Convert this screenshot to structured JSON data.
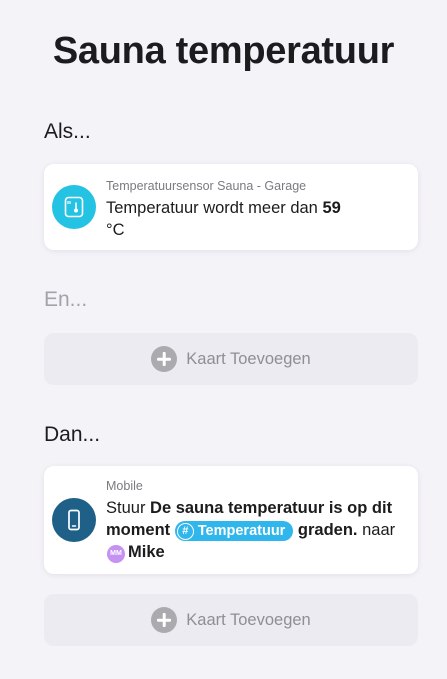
{
  "title": "Sauna temperatuur",
  "sections": {
    "if": {
      "heading": "Als...",
      "card": {
        "icon": "temperature-sensor-icon",
        "icon_color": "#24c2e3",
        "device": "Temperatuursensor Sauna - Garage",
        "text_prefix": "Temperatuur wordt meer dan",
        "value": "59",
        "unit": "°C"
      }
    },
    "and": {
      "heading": "En...",
      "add_card_label": "Kaart Toevoegen"
    },
    "then": {
      "heading": "Dan...",
      "card": {
        "icon": "mobile-phone-icon",
        "icon_color": "#1f6089",
        "device": "Mobile",
        "prefix": "Stuur",
        "message_start": "De sauna temperatuur is op dit moment",
        "tag_label": "Temperatuur",
        "tag_color": "#2fb6ec",
        "message_end": "graden.",
        "to_label": "naar",
        "avatar_initials": "MM",
        "avatar_color": "#c592f3",
        "recipient": "Mike"
      },
      "add_card_label": "Kaart Toevoegen"
    }
  }
}
